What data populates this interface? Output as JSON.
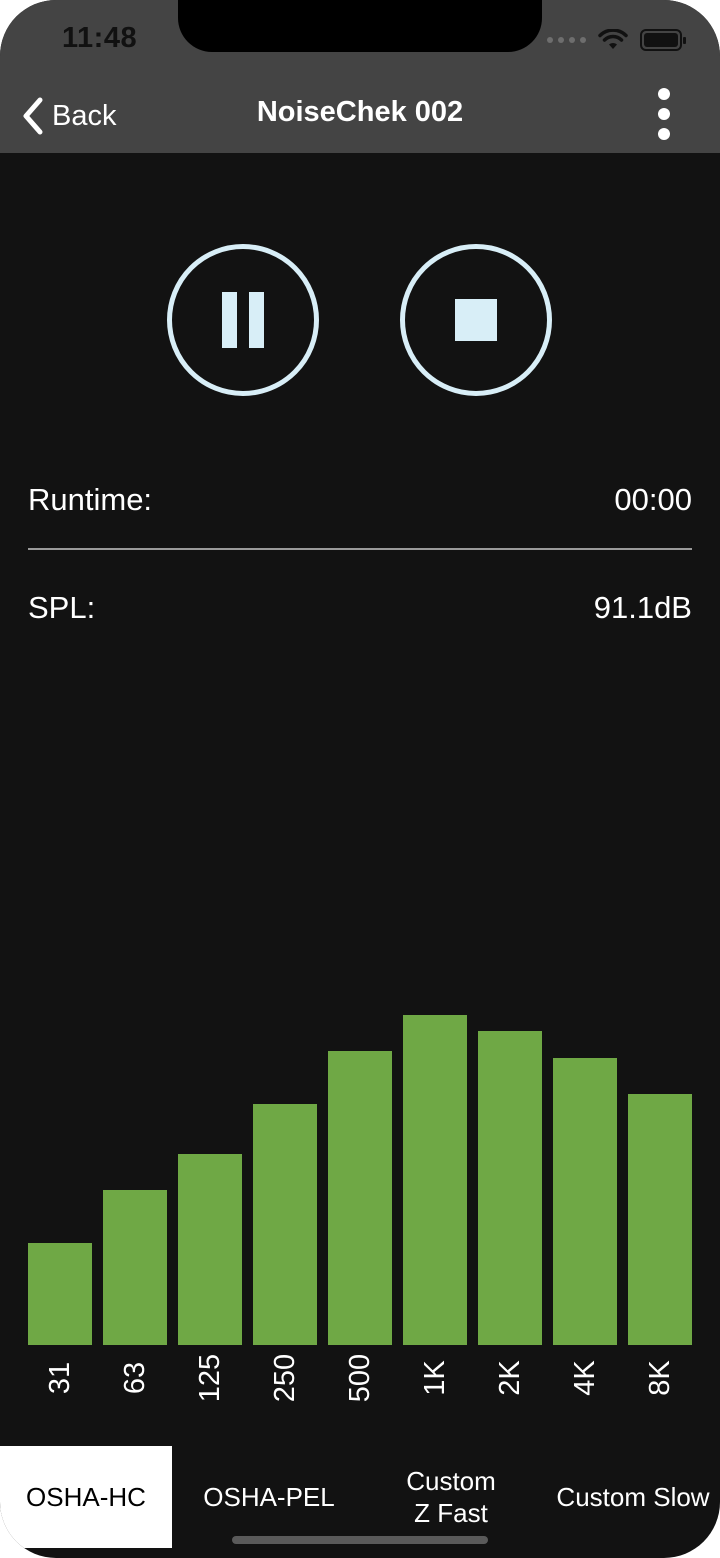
{
  "status_bar": {
    "time": "11:48",
    "icons": [
      "signal-icon",
      "wifi-icon",
      "battery-icon"
    ]
  },
  "nav": {
    "back_label": "Back",
    "title": "NoiseChek 002",
    "more_icon": "more-vertical-icon"
  },
  "controls": {
    "pause_icon": "pause-icon",
    "stop_icon": "stop-icon"
  },
  "info": {
    "runtime_label": "Runtime:",
    "runtime_value": "00:00",
    "spl_label": "SPL:",
    "spl_value": "91.1dB"
  },
  "colors": {
    "bar": "#6fa845",
    "background": "#121212",
    "header": "#444444",
    "control": "#d8eef7"
  },
  "chart_data": {
    "type": "bar",
    "categories": [
      "31",
      "63",
      "125",
      "250",
      "500",
      "1K",
      "2K",
      "4K",
      "8K"
    ],
    "values": [
      0.31,
      0.47,
      0.58,
      0.73,
      0.89,
      1.0,
      0.95,
      0.87,
      0.76
    ],
    "title": "",
    "xlabel": "",
    "ylabel": "",
    "ylim": [
      0,
      1
    ],
    "grid": false
  },
  "tabs": [
    {
      "label": "OSHA-HC",
      "active": true
    },
    {
      "label": "OSHA-PEL",
      "active": false
    },
    {
      "label": "Custom",
      "label2": "Z Fast",
      "active": false
    },
    {
      "label": "Custom Slow",
      "active": false
    }
  ]
}
